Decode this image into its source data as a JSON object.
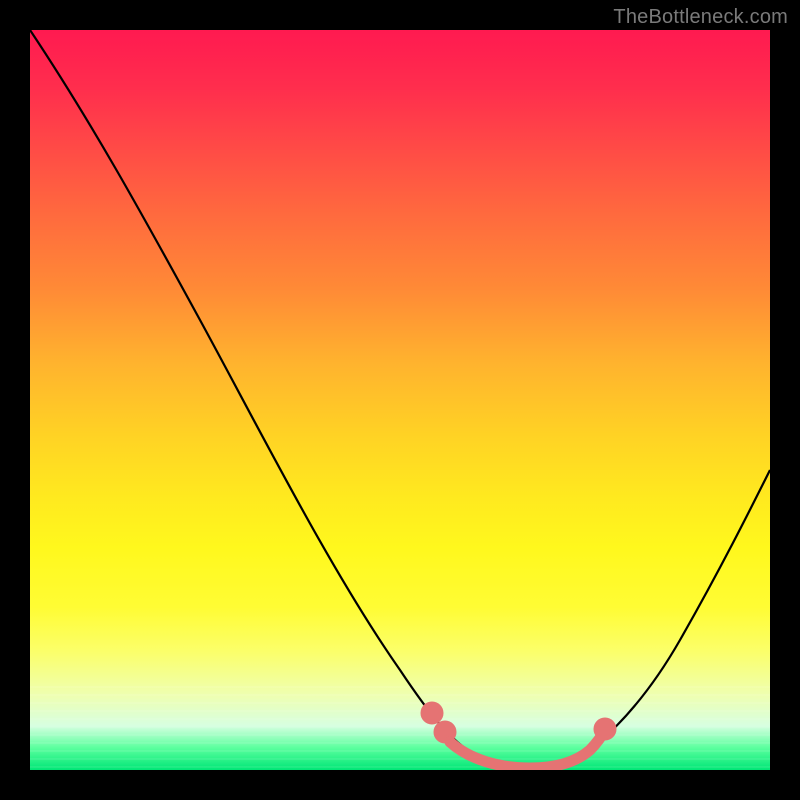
{
  "watermark": "TheBottleneck.com",
  "colors": {
    "frame_bg": "#000000",
    "curve_stroke": "#000000",
    "highlight_stroke": "#e57373",
    "gradient_top": "#ff1a50",
    "gradient_bottom": "#00e676"
  },
  "chart_data": {
    "type": "line",
    "title": "",
    "xlabel": "",
    "ylabel": "",
    "xlim": [
      0,
      100
    ],
    "ylim": [
      0,
      100
    ],
    "grid": false,
    "legend": false,
    "series": [
      {
        "name": "bottleneck-curve",
        "x": [
          0,
          10,
          20,
          30,
          40,
          50,
          56,
          60,
          64,
          68,
          72,
          80,
          88,
          96,
          100
        ],
        "values": [
          100,
          86,
          71,
          56,
          40,
          24,
          12,
          6,
          2,
          0,
          0,
          4,
          16,
          32,
          40
        ]
      }
    ],
    "annotations": [
      {
        "name": "optimal-range-highlight",
        "type": "segment",
        "x_from": 56,
        "x_to": 74,
        "comment": "pink highlighted segment along valley floor"
      }
    ]
  }
}
